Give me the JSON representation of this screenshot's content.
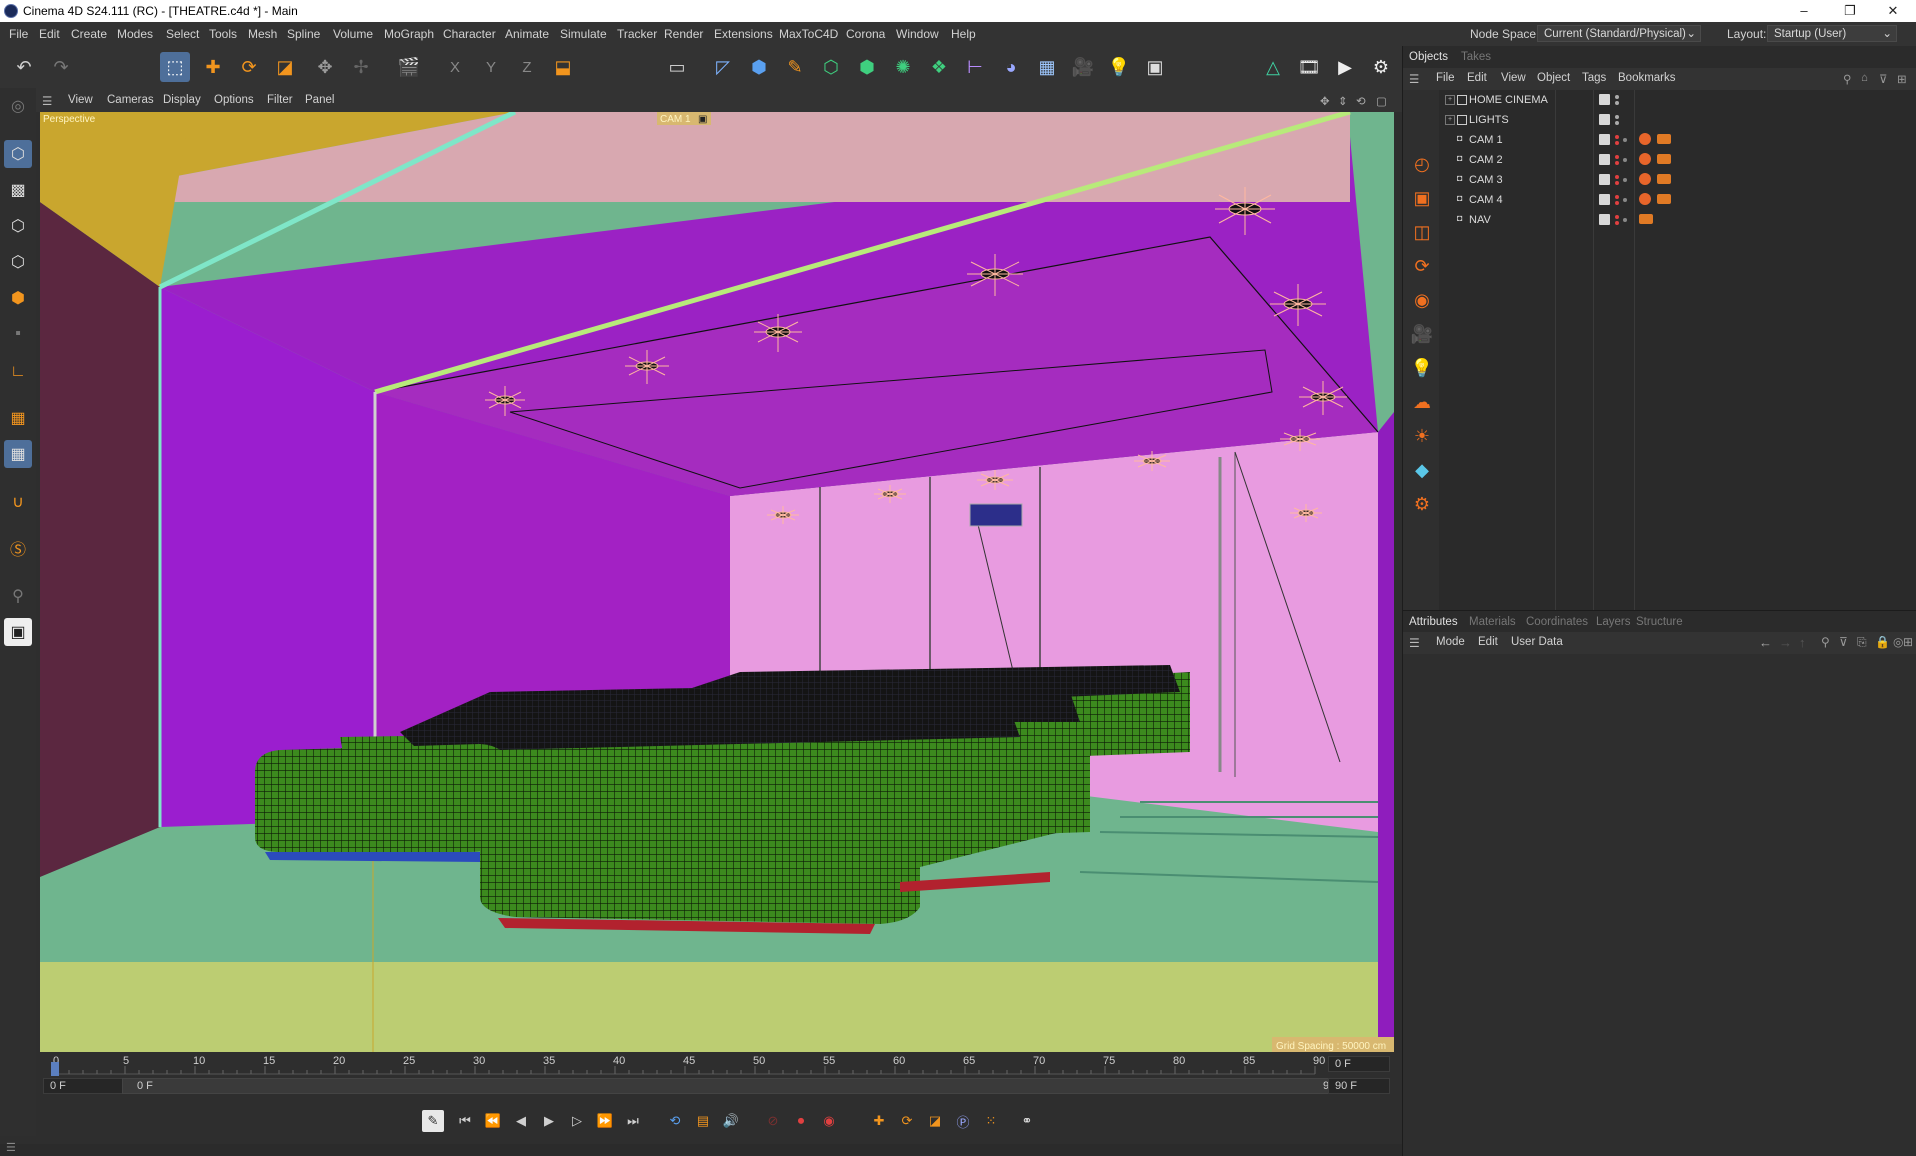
{
  "window": {
    "title": "Cinema 4D S24.111 (RC) - [THEATRE.c4d *] - Main",
    "controls": [
      "–",
      "❐",
      "✕"
    ]
  },
  "menubar": {
    "items": [
      "File",
      "Edit",
      "Create",
      "Modes",
      "Select",
      "Tools",
      "Mesh",
      "Spline",
      "Volume",
      "MoGraph",
      "Character",
      "Animate",
      "Simulate",
      "Tracker",
      "Render",
      "Extensions",
      "MaxToC4D",
      "Corona",
      "Window",
      "Help"
    ],
    "node_space_label": "Node Space:",
    "node_space_value": "Current (Standard/Physical)",
    "layout_label": "Layout:",
    "layout_value": "Startup (User)"
  },
  "toolbar": {
    "icons": [
      "undo-icon",
      "redo-icon",
      "select-icon",
      "move-icon",
      "rotate-icon",
      "scale-icon",
      "transform-icon",
      "last-tool-icon",
      "clapper-icon",
      "x-axis-icon",
      "y-axis-icon",
      "z-axis-icon",
      "coordinate-system-icon",
      "render-region-icon",
      "spline-pen-icon",
      "cube-icon",
      "pen-icon",
      "subdivision-icon",
      "extrude-icon",
      "cloner-icon",
      "fracture-icon",
      "measure-icon",
      "deformer-icon",
      "floor-icon",
      "camera-icon",
      "light-icon",
      "scene-icon",
      "generator-icon",
      "render-view-icon",
      "render-icon",
      "render-settings-icon"
    ],
    "axis_labels": [
      "X",
      "Y",
      "Z"
    ]
  },
  "left_toolbar": {
    "icons": [
      "model-mode-icon",
      "object-mode-icon",
      "texture-mode-icon",
      "points-mode-icon",
      "edges-mode-icon",
      "polygons-mode-icon",
      "uv-mode-icon",
      "axis-mode-icon",
      "workplane-icon",
      "snapping-icon",
      "magnet-icon",
      "s-tool-icon",
      "solo-icon",
      "viewport-solo-icon"
    ]
  },
  "viewport": {
    "menu": [
      "View",
      "Cameras",
      "Display",
      "Options",
      "Filter",
      "Panel"
    ],
    "camera_label": "Perspective",
    "active_camera": "CAM 1",
    "grid_spacing": "Grid Spacing : 50000 cm",
    "colors": {
      "ceiling": "#9b22c4",
      "ceiling_inner": "#a52cbf",
      "left_wall": "#5b2740",
      "front_wall_left": "#9b1ecf",
      "back_wall": "#e89be0",
      "floor": "#6fb58e",
      "floor_bottom": "#bccd72",
      "sofa": "#3c8a1e",
      "top_band_left": "#c9a62e",
      "top_band_right": "#d8a8b0"
    }
  },
  "timeline": {
    "ticks": [
      "0",
      "5",
      "10",
      "15",
      "20",
      "25",
      "30",
      "35",
      "40",
      "45",
      "50",
      "55",
      "60",
      "65",
      "70",
      "75",
      "80",
      "85",
      "90"
    ],
    "current_frame": "0 F",
    "start_field": "0 F",
    "range_start": "0 F",
    "range_end": "90 F",
    "end_field_top": "0 F",
    "end_field": "90 F"
  },
  "transport": {
    "icons": [
      "record-keys-icon",
      "go-start-icon",
      "prev-key-icon",
      "prev-frame-icon",
      "play-icon",
      "next-frame-icon",
      "next-key-icon",
      "go-end-icon",
      "loop-icon",
      "timeline-icon",
      "motion-sound-icon",
      "autokey-off-icon",
      "record-icon",
      "autokey-icon",
      "move-key-icon",
      "rotate-key-icon",
      "scale-key-icon",
      "param-key-icon",
      "pla-key-icon",
      "motion-icon"
    ]
  },
  "objects_panel": {
    "tabs": [
      "Objects",
      "Takes"
    ],
    "menu": [
      "File",
      "Edit",
      "View",
      "Object",
      "Tags",
      "Bookmarks"
    ],
    "rows": [
      {
        "name": "HOME CINEMA",
        "type": "null",
        "tags": false
      },
      {
        "name": "LIGHTS",
        "type": "null",
        "tags": false
      },
      {
        "name": "CAM 1",
        "type": "camera",
        "tags": true
      },
      {
        "name": "CAM 2",
        "type": "camera",
        "tags": true
      },
      {
        "name": "CAM 3",
        "type": "camera",
        "tags": true
      },
      {
        "name": "CAM 4",
        "type": "camera",
        "tags": true
      },
      {
        "name": "NAV",
        "type": "camera",
        "tags": "partial"
      }
    ],
    "side_icons": [
      "structure-icon",
      "rectangle-icon",
      "book-icon",
      "loop-spline-icon",
      "sphere-icon",
      "camera-icon",
      "light-bulb-icon",
      "cloud-icon",
      "sun-icon",
      "material-icon",
      "settings-icon"
    ]
  },
  "attributes_panel": {
    "tabs": [
      "Attributes",
      "Materials",
      "Coordinates",
      "Layers",
      "Structure"
    ],
    "menu": [
      "Mode",
      "Edit",
      "User Data"
    ]
  }
}
